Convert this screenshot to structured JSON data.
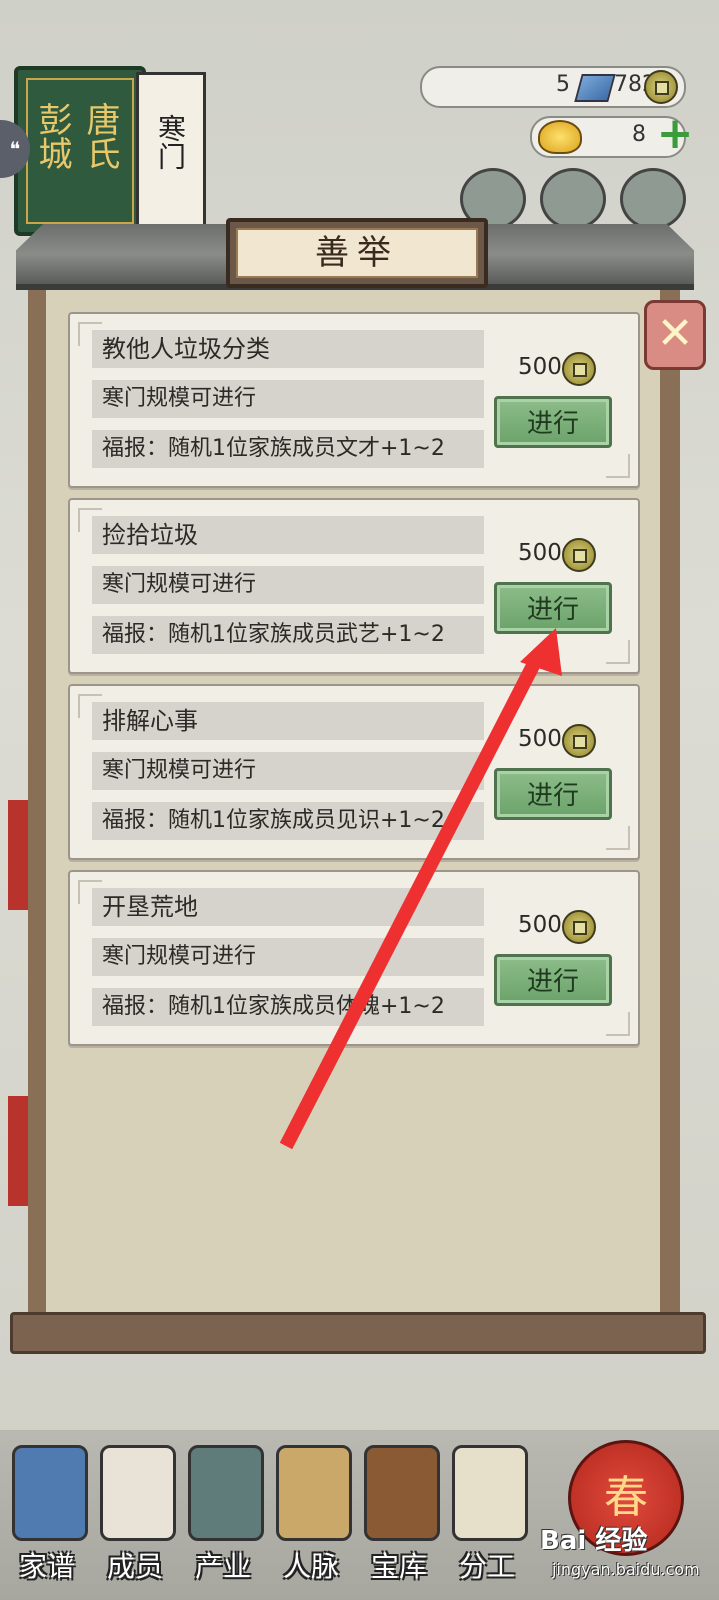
{
  "banner": {
    "surname": "唐氏",
    "city": "彭城",
    "rank": "寒门"
  },
  "resources": {
    "gems": "5",
    "coins": "782",
    "ingots": "8"
  },
  "dialog": {
    "title": "善举",
    "close_label": "✕",
    "action_label": "进行",
    "items": [
      {
        "name": "教他人垃圾分类",
        "condition": "寒门规模可进行",
        "reward": "福报：随机1位家族成员文才+1~2",
        "cost": "500"
      },
      {
        "name": "捡拾垃圾",
        "condition": "寒门规模可进行",
        "reward": "福报：随机1位家族成员武艺+1~2",
        "cost": "500"
      },
      {
        "name": "排解心事",
        "condition": "寒门规模可进行",
        "reward": "福报：随机1位家族成员见识+1~2",
        "cost": "500"
      },
      {
        "name": "开垦荒地",
        "condition": "寒门规模可进行",
        "reward": "福报：随机1位家族成员体魄+1~2",
        "cost": "500"
      }
    ]
  },
  "nav": {
    "items": [
      {
        "label": "家谱",
        "icon": "genealogy-book-icon"
      },
      {
        "label": "成员",
        "icon": "member-portrait-icon"
      },
      {
        "label": "产业",
        "icon": "industry-building-icon"
      },
      {
        "label": "人脉",
        "icon": "network-icon"
      },
      {
        "label": "宝库",
        "icon": "treasure-chest-icon"
      },
      {
        "label": "分工",
        "icon": "scroll-icon"
      }
    ],
    "spring_label": "春"
  },
  "watermark": {
    "main": "Bai 经验",
    "sub": "jingyan.baidu.com"
  },
  "annotation": {
    "arrow_color": "#ef3030"
  }
}
